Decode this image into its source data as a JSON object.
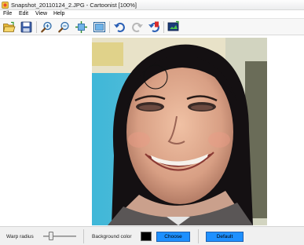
{
  "window": {
    "title": "Snapshot_20110124_2.JPG - Cartoonist [100%]"
  },
  "menu": {
    "items": [
      {
        "label": "File"
      },
      {
        "label": "Edit"
      },
      {
        "label": "View"
      },
      {
        "label": "Help"
      }
    ]
  },
  "toolbar": {
    "buttons": [
      {
        "icon": "open-folder-icon"
      },
      {
        "icon": "save-icon"
      },
      {
        "icon": "zoom-in-icon"
      },
      {
        "icon": "zoom-out-icon"
      },
      {
        "icon": "fit-to-window-icon"
      },
      {
        "icon": "actual-size-icon"
      },
      {
        "icon": "undo-icon"
      },
      {
        "icon": "redo-icon"
      },
      {
        "icon": "reset-icon"
      },
      {
        "icon": "export-icon"
      }
    ]
  },
  "bottom": {
    "warp_label": "Warp radius",
    "warp_value": 0.2,
    "bg_label": "Background color",
    "bg_color": "#000000",
    "choose_label": "Choose",
    "default_label": "Default"
  },
  "colors": {
    "accent": "#1e90ff"
  }
}
